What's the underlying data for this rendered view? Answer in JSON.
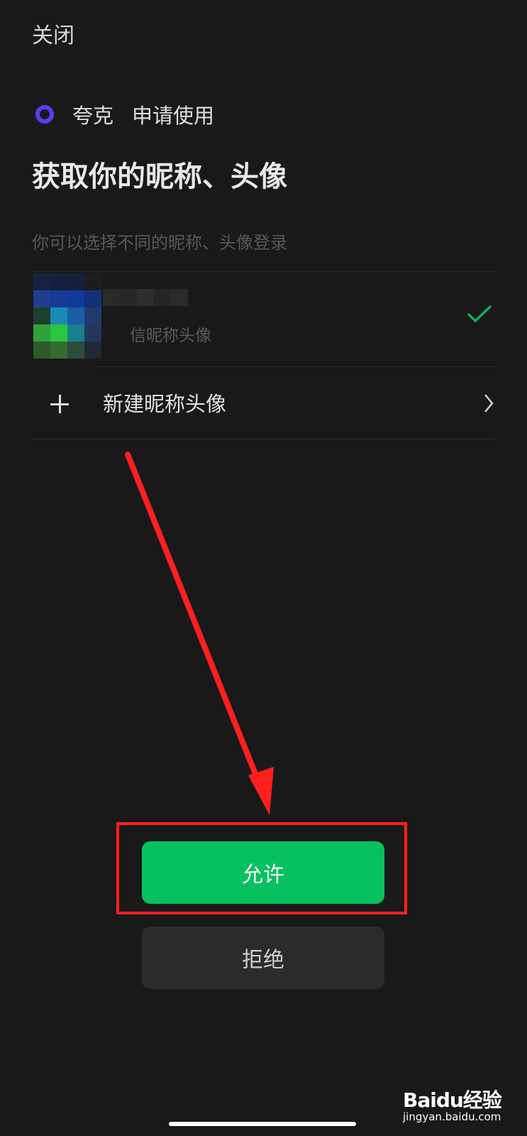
{
  "header": {
    "close_label": "关闭"
  },
  "app": {
    "name": "夸克",
    "request": "申请使用",
    "logo_color": "#5b3cf0"
  },
  "title": "获取你的昵称、头像",
  "subtitle": "你可以选择不同的昵称、头像登录",
  "options": {
    "current": {
      "label": "信昵称头像",
      "selected": true,
      "icon": "check-icon"
    },
    "new": {
      "label": "新建昵称头像",
      "icon": "plus-icon",
      "trailing_icon": "chevron-right-icon"
    }
  },
  "buttons": {
    "allow_label": "允许",
    "allow_color": "#07c160",
    "deny_label": "拒绝"
  },
  "annotation": {
    "arrow_color": "#ff1f1f",
    "box_color": "#ff1f1f"
  },
  "watermark": {
    "brand": "Baidu经验",
    "url": "jingyan.baidu.com"
  }
}
